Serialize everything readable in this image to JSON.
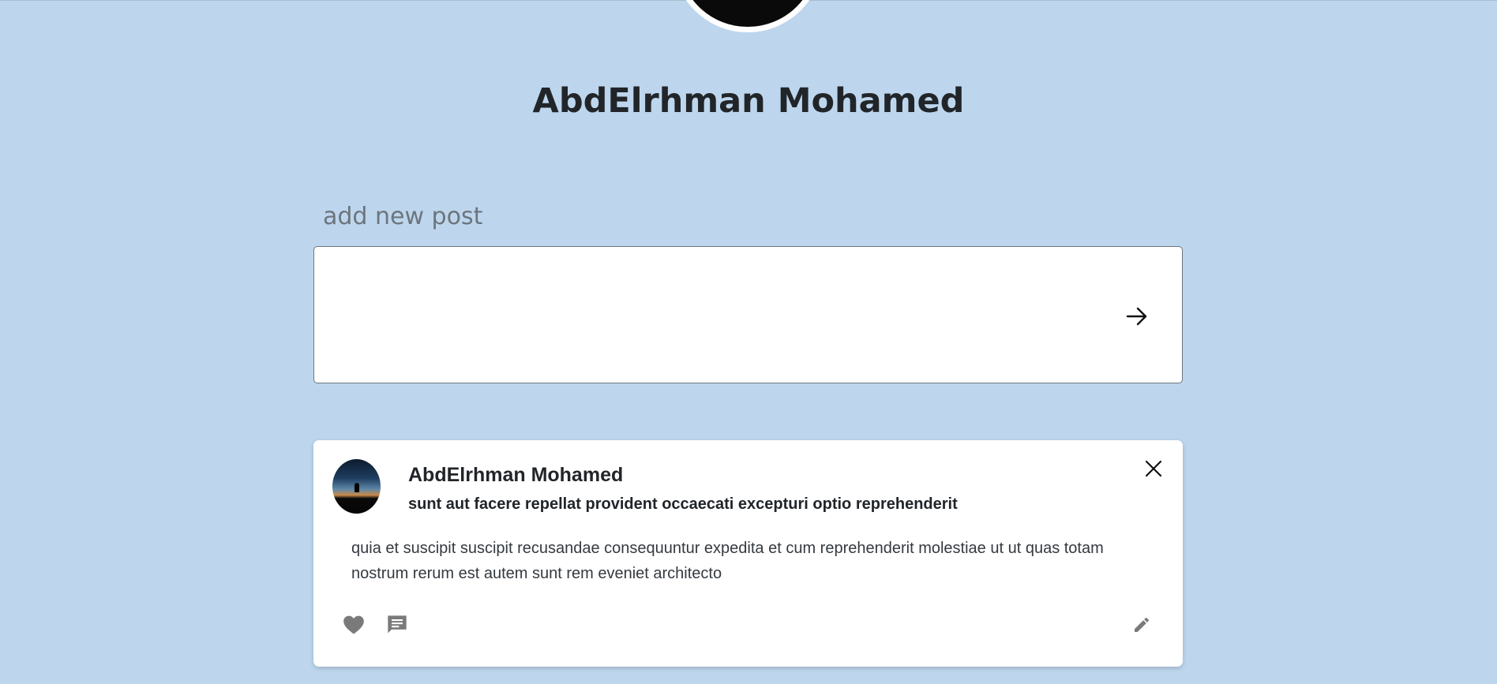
{
  "profile": {
    "name": "AbdElrhman Mohamed"
  },
  "new_post": {
    "label": "add new post",
    "input_value": "",
    "submit_icon": "arrow-right-icon"
  },
  "posts": [
    {
      "author": "AbdElrhman Mohamed",
      "title": "sunt aut facere repellat provident occaecati excepturi optio reprehenderit",
      "body": "quia et suscipit suscipit recusandae consequuntur expedita et cum reprehenderit molestiae ut ut quas totam nostrum rerum est autem sunt rem eveniet architecto",
      "icons": {
        "close": "close-icon",
        "like": "heart-icon",
        "comment": "comment-icon",
        "edit": "pencil-icon"
      }
    }
  ],
  "colors": {
    "background": "#bdd6ed",
    "card": "#ffffff",
    "text": "#212529",
    "muted": "#6c757d",
    "icon_gray": "#7a7a7a"
  }
}
